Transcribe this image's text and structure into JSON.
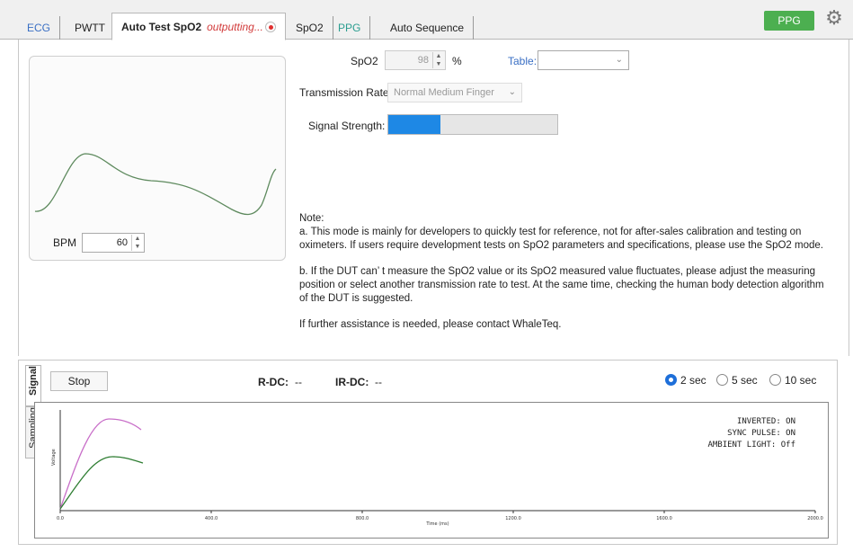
{
  "tabs": [
    {
      "label": "ECG",
      "color": "#3a6fc4"
    },
    {
      "label": "PWTT",
      "color": "#222222"
    },
    {
      "label": "Auto Test SpO2",
      "status": "outputting...",
      "active": true
    },
    {
      "label": "SpO2",
      "color": "#222222"
    },
    {
      "label": "PPG",
      "color": "#2a9d8f"
    },
    {
      "label": "Auto Sequence",
      "color": "#222222"
    }
  ],
  "header": {
    "ppg_button": "PPG",
    "accent": "#4caf50"
  },
  "left_panel": {
    "bpm_label": "BPM",
    "bpm_value": "60"
  },
  "settings": {
    "spo2_label": "SpO2",
    "spo2_value": "98",
    "spo2_unit": "%",
    "table_label": "Table:",
    "table_value": "",
    "transmission_label": "Transmission Rate",
    "transmission_value": "Normal Medium Finger",
    "signal_label": "Signal Strength:",
    "signal_strength": 0.31
  },
  "notes": {
    "title": "Note:",
    "a": "a. This mode is mainly for developers to quickly test for reference, not for after-sales calibration and testing on oximeters. If users require development tests on SpO2 parameters and specifications, please use the SpO2 mode.",
    "b": "b. If the DUT can’ t measure the SpO2 value or its SpO2 measured value fluctuates, please adjust the measuring position or select another transmission rate to test. At the same time, checking the human body detection algorithm of the DUT is suggested.",
    "c": "If further assistance is needed, please contact WhaleTeq."
  },
  "signal_panel": {
    "tab_signal": "Signal",
    "tab_sampling": "Sampling",
    "stop_button": "Stop",
    "rdc_label": "R-DC:",
    "rdc_value": "--",
    "irdc_label": "IR-DC:",
    "irdc_value": "--",
    "radio_options": [
      "2 sec",
      "5 sec",
      "10 sec"
    ],
    "radio_selected": 0
  },
  "plot": {
    "ylabel": "Voltage",
    "xlabel": "Time (ms)",
    "x_ticks": [
      "0.0",
      "400.0",
      "800.0",
      "1200.0",
      "1600.0",
      "2000.0"
    ],
    "status_lines": [
      "INVERTED: ON",
      "SYNC PULSE: ON",
      "AMBIENT LIGHT: Off"
    ],
    "series_colors": [
      "#c86ec8",
      "#2e7d32"
    ]
  }
}
